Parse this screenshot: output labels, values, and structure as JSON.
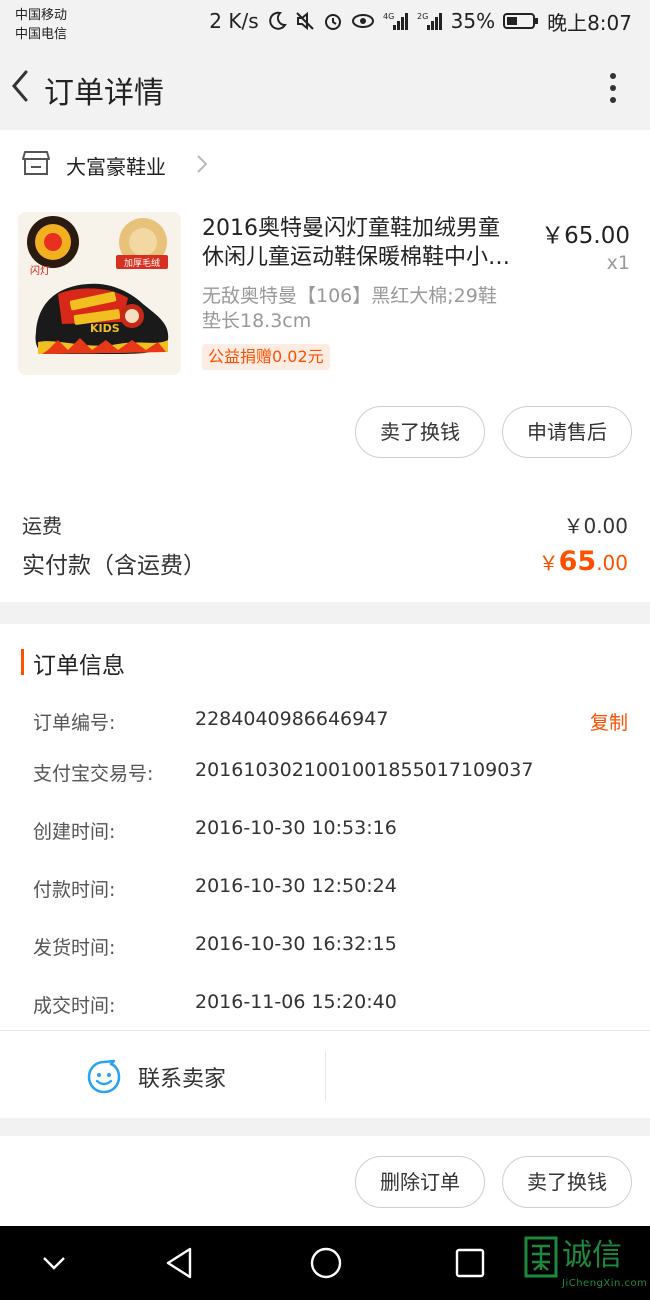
{
  "status_bar": {
    "carrier1": "中国移动",
    "carrier2": "中国电信",
    "speed": "2 K/s",
    "battery": "35%",
    "time": "晚上8:07",
    "icons": [
      "moon-icon",
      "mute-icon",
      "alarm-icon",
      "eye-icon",
      "signal-4g-icon",
      "signal-2g-icon",
      "battery-icon"
    ]
  },
  "header": {
    "title": "订单详情"
  },
  "shop": {
    "name": "大富豪鞋业"
  },
  "product": {
    "title_line1": "2016奥特曼闪灯童鞋加绒男童",
    "title_line2": "休闲儿童运动鞋保暖棉鞋中小…",
    "price": "￥65.00",
    "quantity": "x1",
    "sku_line1": "无敌奥特曼【106】黑红大棉;29鞋",
    "sku_line2": "垫长18.3cm",
    "charity": "公益捐赠0.02元",
    "image_labels": {
      "flash": "闪灯",
      "fleece": "加厚毛绒",
      "brand": "KIDS"
    }
  },
  "item_actions": {
    "sell": "卖了换钱",
    "after_sale": "申请售后"
  },
  "fees": {
    "shipping_label": "运费",
    "shipping_value": "￥0.00",
    "total_label": "实付款（含运费）",
    "total_currency": "￥",
    "total_main": "65",
    "total_decimal": ".00"
  },
  "order_info": {
    "title": "订单信息",
    "copy": "复制",
    "rows": [
      {
        "key": "订单编号:",
        "value": "2284040986646947"
      },
      {
        "key": "支付宝交易号:",
        "value": "2016103021001001855017109037"
      },
      {
        "key": "创建时间:",
        "value": "2016-10-30 10:53:16"
      },
      {
        "key": "付款时间:",
        "value": "2016-10-30 12:50:24"
      },
      {
        "key": "发货时间:",
        "value": "2016-10-30 16:32:15"
      },
      {
        "key": "成交时间:",
        "value": "2016-11-06 15:20:40"
      }
    ]
  },
  "contact": {
    "label": "联系卖家"
  },
  "bottom_actions": {
    "delete": "删除订单",
    "sell": "卖了换钱"
  },
  "watermark": {
    "text": "诚信",
    "sub": "JiChengXin.com"
  },
  "colors": {
    "accent": "#ff5000",
    "page_bg": "#f2f2f2",
    "card_bg": "#ffffff"
  }
}
